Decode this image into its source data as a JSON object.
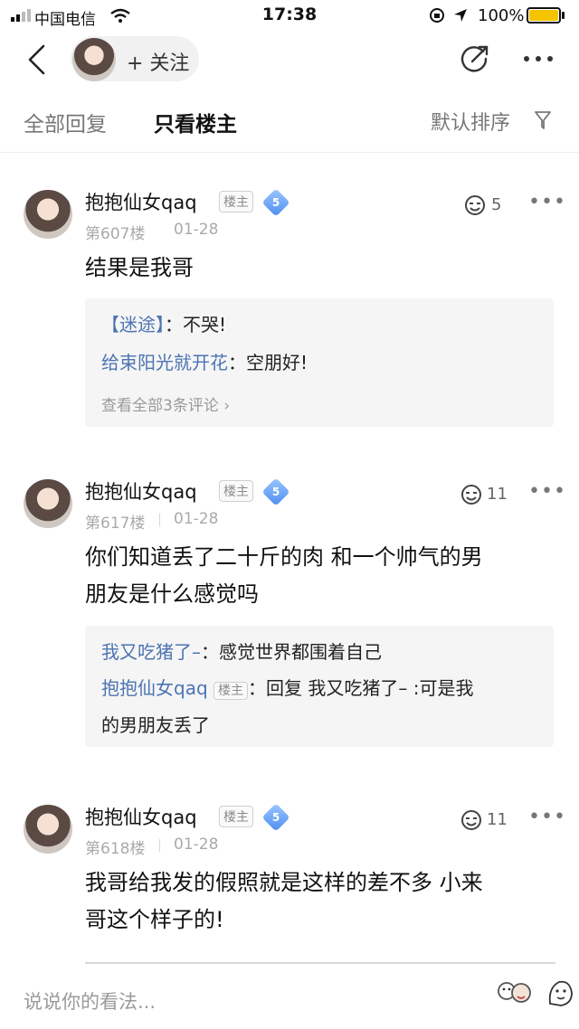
{
  "status_bar": {
    "carrier": "中国电信",
    "time": "17:38",
    "battery_pct": "100%",
    "battery_level": 1.0
  },
  "nav": {
    "follow_label": "+ 关注"
  },
  "tabs": {
    "all_replies": "全部回复",
    "op_only": "只看楼主",
    "sort_label": "默认排序"
  },
  "posts": [
    {
      "user": "抱抱仙女qaq",
      "op_badge": "楼主",
      "level": "5",
      "floor": "第607楼",
      "date": "01-28",
      "likes": "5",
      "lines": [
        "结果是我哥"
      ],
      "replies": [
        {
          "name": "【迷途】",
          "sep": "：",
          "text": "不哭!"
        },
        {
          "name": "给束阳光就开花",
          "sep": "：",
          "text": "空朋好!"
        }
      ],
      "view_all": "查看全部3条评论"
    },
    {
      "user": "抱抱仙女qaq",
      "op_badge": "楼主",
      "level": "5",
      "floor": "第617楼",
      "date": "01-28",
      "likes": "11",
      "lines": [
        "你们知道丢了二十斤的肉 和一个帅气的男",
        "朋友是什么感觉吗"
      ],
      "replies": [
        {
          "name": "我又吃猪了–",
          "sep": "：",
          "text": "感觉世界都围着自己"
        },
        {
          "name": "抱抱仙女qaq",
          "badge": "楼主",
          "sep": "：",
          "text": "回复 我又吃猪了– :可是我",
          "text2": "的男朋友丢了"
        }
      ]
    },
    {
      "user": "抱抱仙女qaq",
      "op_badge": "楼主",
      "level": "5",
      "floor": "第618楼",
      "date": "01-28",
      "likes": "11",
      "lines": [
        "我哥给我发的假照就是这样的差不多 小来",
        "哥这个样子的!"
      ]
    }
  ],
  "comment_input": {
    "placeholder": "说说你的看法..."
  },
  "colors": {
    "link_blue": "#4c74b2",
    "level_badge": "#4e8ef0",
    "battery": "#f5c400"
  }
}
